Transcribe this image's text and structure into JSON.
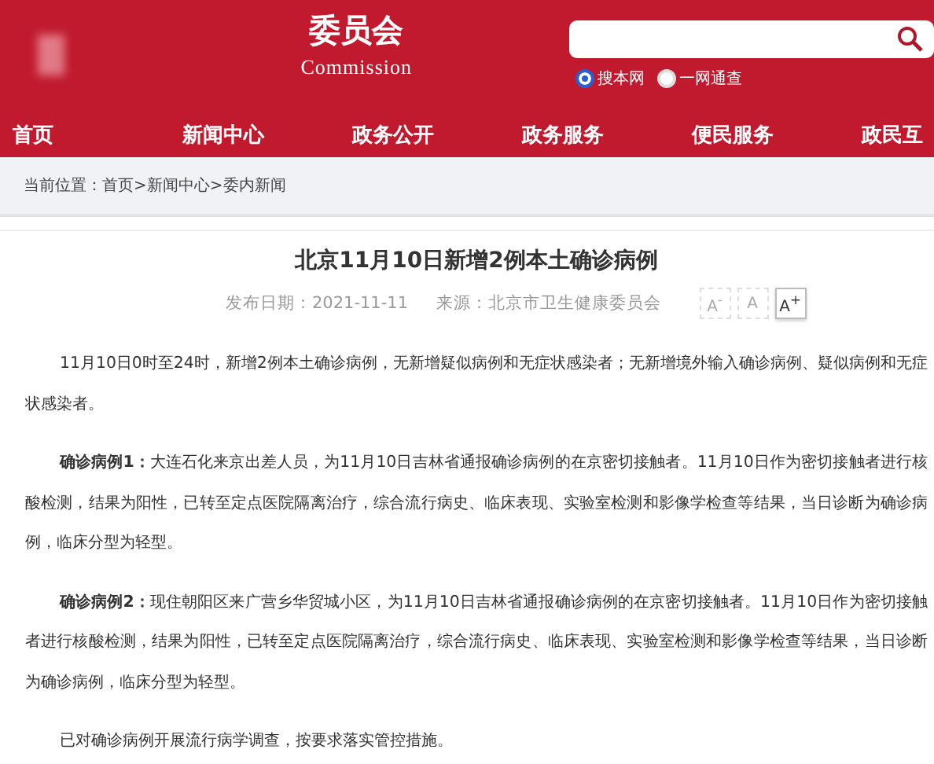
{
  "header": {
    "title": "委员会",
    "subtitle": "Commission",
    "scopes": [
      {
        "label": "搜本网",
        "selected": true
      },
      {
        "label": "一网通查",
        "selected": false
      }
    ]
  },
  "nav": [
    "首页",
    "新闻中心",
    "政务公开",
    "政务服务",
    "便民服务",
    "政民互"
  ],
  "breadcrumb": "当前位置：首页>新闻中心>委内新闻",
  "article": {
    "title": "北京11月10日新增2例本土确诊病例",
    "date": "发布日期：2021-11-11",
    "source": "来源：北京市卫生健康委员会",
    "font_sizes": [
      {
        "label": "A$^{-}$",
        "selected": false
      },
      {
        "label": "A",
        "selected": false
      },
      {
        "label": "A$^{+}$",
        "selected": true
      }
    ],
    "paragraphs": [
      "11月10日0时至24时，新增2例本土确诊病例，无新增疑似病例和无症状感染者；无新增境外输入确诊病例、疑似病例和无症状感染者。",
      "**确诊病例1：**大连石化来京出差人员，为11月10日吉林省通报确诊病例的在京密切接触者。11月10日作为密切接触者进行核酸检测，结果为阳性，已转至定点医院隔离治疗，综合流行病史、临床表现、实验室检测和影像学检查等结果，当日诊断为确诊病例，临床分型为轻型。",
      "**确诊病例2：**现住朝阳区来广营乡华贸城小区，为11月10日吉林省通报确诊病例的在京密切接触者。11月10日作为密切接触者进行核酸检测，结果为阳性，已转至定点医院隔离治疗，综合流行病史、临床表现、实验室检测和影像学检查等结果，当日诊断为确诊病例，临床分型为轻型。",
      "已对确诊病例开展流行病学调查，按要求落实管控措施。"
    ]
  }
}
